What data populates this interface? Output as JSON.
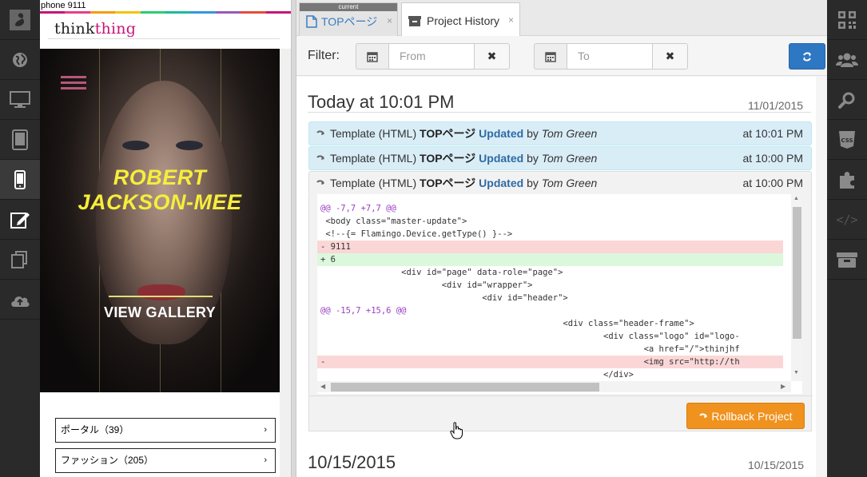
{
  "preview": {
    "label": "phone 9111",
    "brand_part1": "think",
    "brand_part2": "thing",
    "hero_title_line1": "ROBERT",
    "hero_title_line2": "JACKSON-MEE",
    "gallery_label": "VIEW GALLERY",
    "categories": [
      {
        "label": "ポータル（39）"
      },
      {
        "label": "ファッション（205）"
      }
    ],
    "strip_colors": [
      "#c7157a",
      "#e83e8c",
      "#f39c12",
      "#f1c40f",
      "#2ecc71",
      "#1abc9c",
      "#3498db",
      "#9b59b6",
      "#e74c3c",
      "#c7157a"
    ]
  },
  "left_nav": [
    {
      "icon": "flamingo-logo-icon"
    },
    {
      "icon": "globe-icon"
    },
    {
      "icon": "desktop-icon"
    },
    {
      "icon": "tablet-icon"
    },
    {
      "icon": "phone-icon",
      "active": true
    },
    {
      "icon": "edit-icon"
    },
    {
      "icon": "copy-icon"
    },
    {
      "icon": "cloud-upload-icon"
    }
  ],
  "right_nav": [
    {
      "icon": "qr-code-icon"
    },
    {
      "icon": "users-icon"
    },
    {
      "icon": "search-icon"
    },
    {
      "icon": "css-icon",
      "label": "CSS"
    },
    {
      "icon": "puzzle-icon"
    },
    {
      "icon": "code-icon",
      "label": "</>"
    },
    {
      "icon": "archive-icon"
    }
  ],
  "tabs": [
    {
      "badge": "current",
      "label": "TOPページ",
      "icon": "file-icon",
      "close": "×"
    },
    {
      "label": "Project History",
      "icon": "archive-icon",
      "close": "×"
    }
  ],
  "filter": {
    "label": "Filter:",
    "from_placeholder": "From",
    "to_placeholder": "To",
    "clear": "✖"
  },
  "sections": [
    {
      "date": "Today at 10:01 PM",
      "date_right": "11/01/2015",
      "entries": [
        {
          "type": "Template (HTML)",
          "page": "TOPページ",
          "action": "Updated",
          "by": "by",
          "user": "Tom Green",
          "time": "at 10:01 PM"
        },
        {
          "type": "Template (HTML)",
          "page": "TOPページ",
          "action": "Updated",
          "by": "by",
          "user": "Tom Green",
          "time": "at 10:00 PM"
        },
        {
          "type": "Template (HTML)",
          "page": "TOPページ",
          "action": "Updated",
          "by": "by",
          "user": "Tom Green",
          "time": "at 10:00 PM"
        }
      ]
    },
    {
      "date": "10/15/2015",
      "date_right": "10/15/2015"
    }
  ],
  "diff": {
    "lines": [
      {
        "kind": "h",
        "text": "@@ -7,7 +7,7 @@"
      },
      {
        "kind": "ctx",
        "text": " <body class=\"master-update\">"
      },
      {
        "kind": "ctx",
        "text": " <!--{= Flamingo.Device.getType() }-->"
      },
      {
        "kind": "del",
        "text": "- 9111"
      },
      {
        "kind": "add",
        "text": "+ 6"
      },
      {
        "kind": "ctx",
        "text": "                <div id=\"page\" data-role=\"page\">"
      },
      {
        "kind": "ctx",
        "text": "                        <div id=\"wrapper\">"
      },
      {
        "kind": "ctx",
        "text": "                                <div id=\"header\">"
      },
      {
        "kind": "h",
        "text": "@@ -15,7 +15,6 @@"
      },
      {
        "kind": "ctx",
        "text": "                                                <div class=\"header-frame\">"
      },
      {
        "kind": "ctx",
        "text": "                                                        <div class=\"logo\" id=\"logo-"
      },
      {
        "kind": "ctx",
        "text": "                                                                <a href=\"/\">thinjhf"
      },
      {
        "kind": "del",
        "text": "-                                                               <img src=\"http://th"
      },
      {
        "kind": "ctx",
        "text": "                                                        </div>"
      }
    ]
  },
  "rollback_label": "Rollback Project",
  "colors": {
    "accent": "#2e77c2",
    "rollback": "#f0921e",
    "highlight_row": "#d9edf7",
    "hero_title": "#f6ee3b",
    "brand_pink": "#c7157a"
  }
}
